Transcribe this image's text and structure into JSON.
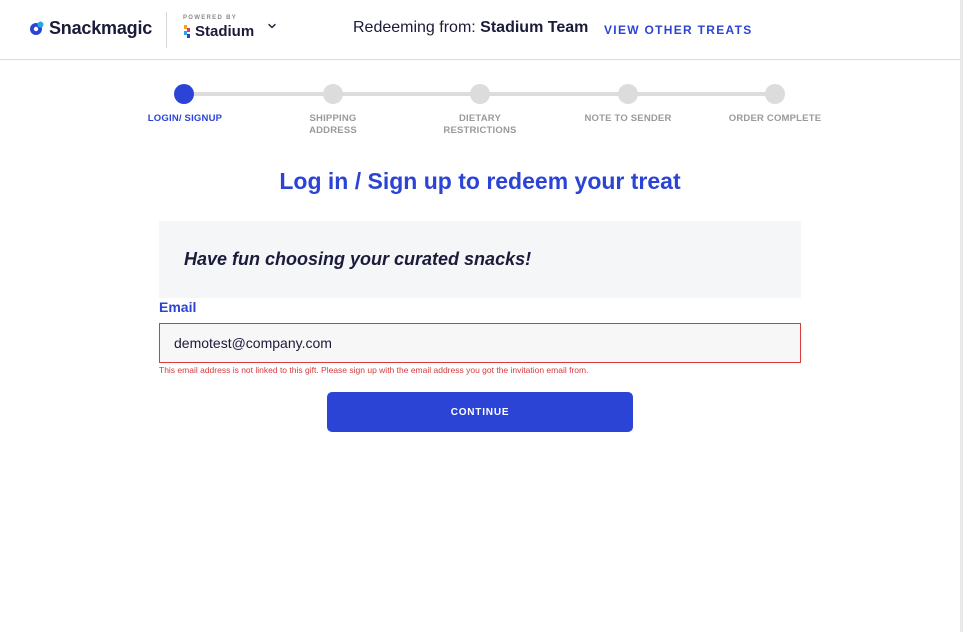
{
  "header": {
    "brand_name": "Snackmagic",
    "powered_by_label": "POWERED BY",
    "partner_name": "Stadium",
    "redeeming_prefix": "Redeeming from: ",
    "redeeming_team": "Stadium Team",
    "view_other_treats": "VIEW OTHER TREATS"
  },
  "stepper": {
    "active_index": 0,
    "steps": [
      {
        "label": "LOGIN/ SIGNUP"
      },
      {
        "label": "SHIPPING ADDRESS"
      },
      {
        "label": "DIETARY RESTRICTIONS"
      },
      {
        "label": "NOTE TO SENDER"
      },
      {
        "label": "ORDER COMPLETE"
      }
    ]
  },
  "main": {
    "title": "Log in / Sign up to redeem your treat",
    "banner_text": "Have fun choosing your curated snacks!",
    "email_label": "Email",
    "email_value": "demotest@company.com",
    "error_text": "This email address is not linked to this gift. Please sign up with the email address you got the invitation email from.",
    "continue_label": "CONTINUE"
  },
  "colors": {
    "accent": "#2c44d6",
    "error": "#d93a3a",
    "text_dark": "#1b1b3a",
    "inactive_step": "#dcdcdc"
  },
  "icons": [
    "snackmagic-logo-icon",
    "stadium-logo-icon",
    "chevron-down-icon"
  ]
}
